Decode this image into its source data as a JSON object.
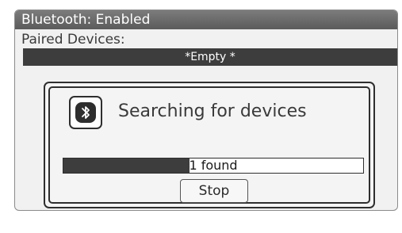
{
  "title_bar": {
    "text": "Bluetooth: Enabled"
  },
  "paired": {
    "label": "Paired Devices:",
    "empty_text": "*Empty *"
  },
  "dialog": {
    "icon": "bluetooth-icon",
    "message": "Searching for devices",
    "progress": {
      "label": "1 found",
      "fill_fraction": 0.42
    },
    "stop_label": "Stop"
  },
  "colors": {
    "title_bar": "#6b6b6b",
    "empty_bar": "#3d3d3d",
    "background": "#f1f1f1"
  }
}
